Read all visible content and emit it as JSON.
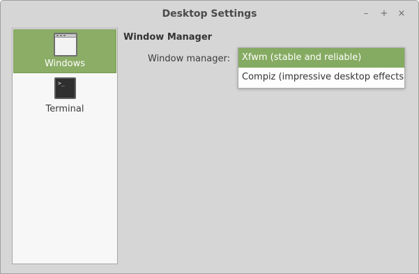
{
  "window": {
    "title": "Desktop Settings",
    "controls": {
      "minimize": "–",
      "maximize": "+",
      "close": "×"
    }
  },
  "sidebar": {
    "items": [
      {
        "label": "Windows",
        "icon": "window-icon",
        "selected": true
      },
      {
        "label": "Terminal",
        "icon": "terminal-icon",
        "selected": false,
        "icon_text": ">_"
      }
    ]
  },
  "main": {
    "section_title": "Window Manager",
    "window_manager_label": "Window manager:",
    "dropdown": {
      "options": [
        {
          "label": "Xfwm (stable and reliable)",
          "selected": true
        },
        {
          "label": "Compiz (impressive desktop effects)",
          "selected": false
        }
      ]
    }
  },
  "colors": {
    "accent": "#8bad66",
    "window_bg": "#d6d6d6",
    "sidebar_bg": "#f7f7f7"
  }
}
